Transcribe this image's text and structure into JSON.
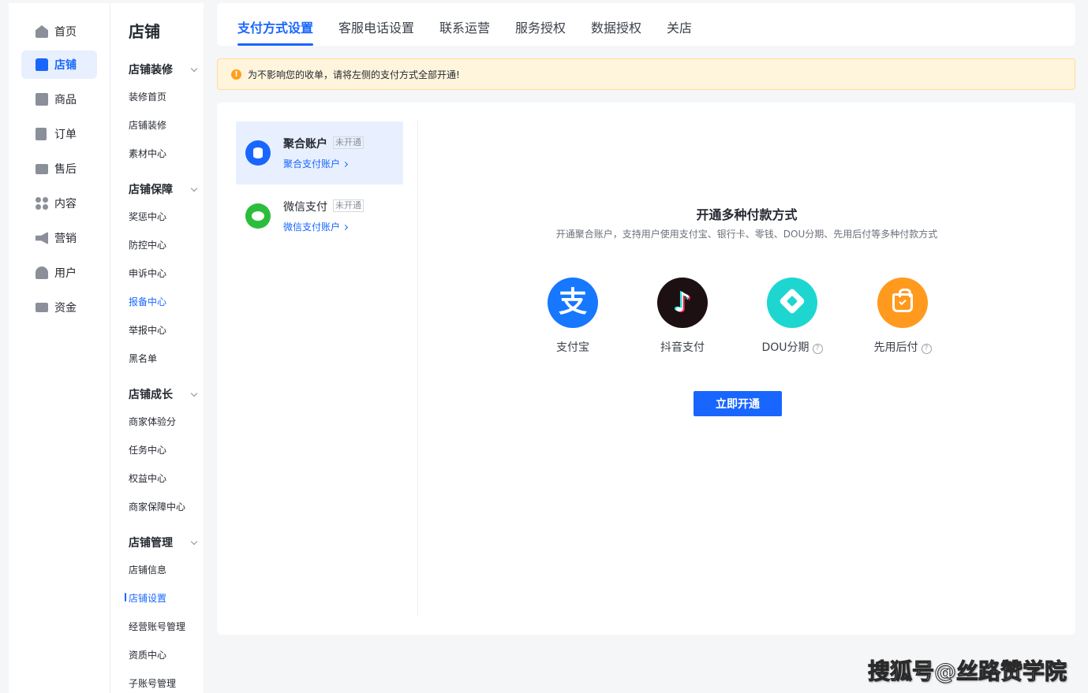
{
  "primary_nav": [
    {
      "label": "首页",
      "icon": "home-icon"
    },
    {
      "label": "店铺",
      "icon": "shop-icon",
      "active": true
    },
    {
      "label": "商品",
      "icon": "product-icon"
    },
    {
      "label": "订单",
      "icon": "order-icon"
    },
    {
      "label": "售后",
      "icon": "after-sale-icon"
    },
    {
      "label": "内容",
      "icon": "content-icon"
    },
    {
      "label": "营销",
      "icon": "megaphone-icon"
    },
    {
      "label": "用户",
      "icon": "user-icon"
    },
    {
      "label": "资金",
      "icon": "wallet-icon"
    }
  ],
  "secondary_nav": {
    "title": "店铺",
    "groups": [
      {
        "label": "店铺装修",
        "items": [
          "装修首页",
          "店铺装修",
          "素材中心"
        ]
      },
      {
        "label": "店铺保障",
        "items": [
          "奖惩中心",
          "防控中心",
          "申诉中心",
          "报备中心",
          "举报中心",
          "黑名单"
        ]
      },
      {
        "label": "店铺成长",
        "items": [
          "商家体验分",
          "任务中心",
          "权益中心",
          "商家保障中心"
        ]
      },
      {
        "label": "店铺管理",
        "items": [
          "店铺信息",
          "店铺设置",
          "经营账号管理",
          "资质中心",
          "子账号管理"
        ]
      }
    ],
    "highlighted_item": "报备中心",
    "current_item": "店铺设置"
  },
  "tabs": [
    "支付方式设置",
    "客服电话设置",
    "联系运营",
    "服务授权",
    "数据授权",
    "关店"
  ],
  "active_tab": "支付方式设置",
  "notice": {
    "icon": "warning-icon",
    "text": "为不影响您的收单，请将左侧的支付方式全部开通!"
  },
  "payment_accounts": [
    {
      "name": "聚合账户",
      "status": "未开通",
      "link": "聚合支付账户",
      "active": true
    },
    {
      "name": "微信支付",
      "status": "未开通",
      "link": "微信支付账户",
      "active": false
    }
  ],
  "hero": {
    "title": "开通多种付款方式",
    "subtitle": "开通聚合账户，支持用户使用支付宝、银行卡、零钱、DOU分期、先用后付等多种付款方式"
  },
  "methods": [
    {
      "label": "支付宝",
      "icon": "alipay-icon",
      "help": false
    },
    {
      "label": "抖音支付",
      "icon": "douyin-pay-icon",
      "help": false
    },
    {
      "label": "DOU分期",
      "icon": "dou-installment-icon",
      "help": true
    },
    {
      "label": "先用后付",
      "icon": "pay-later-icon",
      "help": true
    }
  ],
  "cta_label": "立即开通",
  "watermark": "搜狐号@丝路赞学院",
  "colors": {
    "primary": "#1966ff",
    "notice_bg": "#fff4dc",
    "warning": "#ff9f1a",
    "alipay": "#1677ff",
    "wechat": "#2bbd3c",
    "dou": "#1ed6d0",
    "pay_later": "#ff9a1f"
  }
}
